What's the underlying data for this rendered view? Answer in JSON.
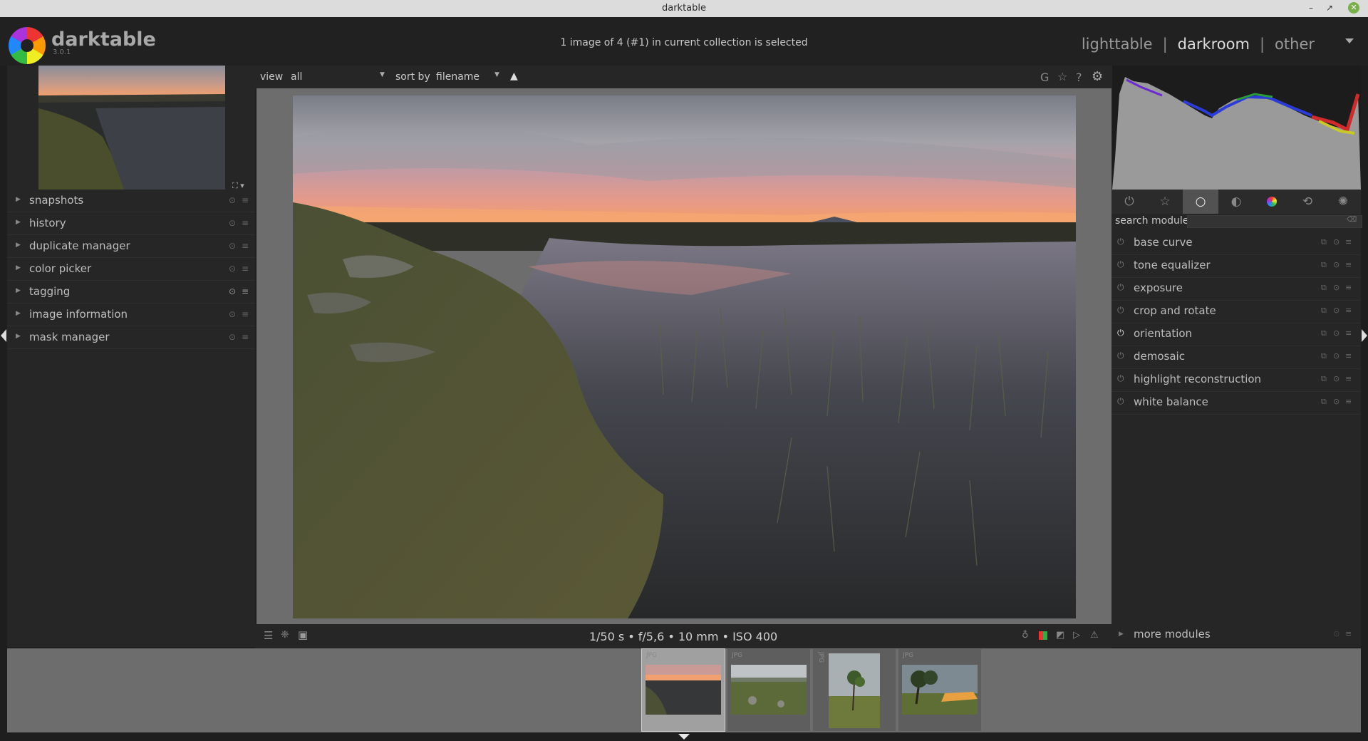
{
  "window": {
    "title": "darktable"
  },
  "header": {
    "brand": "darktable",
    "version": "3.0.1",
    "collection_info": "1 image of 4 (#1) in current collection is selected",
    "views": [
      "lighttable",
      "darkroom",
      "other"
    ],
    "active_view": "darkroom",
    "separator": "|"
  },
  "left_panel": {
    "modules": [
      "snapshots",
      "history",
      "duplicate manager",
      "color picker",
      "tagging",
      "image information",
      "mask manager"
    ]
  },
  "toolbar": {
    "view_label": "view",
    "view_value": "all",
    "sort_label": "sort by",
    "sort_value": "filename",
    "right_icons": [
      "G",
      "☆",
      "?",
      "⚙"
    ]
  },
  "image": {
    "exif": "1/50 s • f/5,6 • 10 mm • ISO 400"
  },
  "right_panel": {
    "search_label": "search module",
    "search_value": "",
    "group_tabs": [
      "power-icon",
      "favourites-icon",
      "base-icon",
      "tone-icon",
      "color-icon",
      "correct-icon",
      "effect-icon"
    ],
    "active_group": "base-icon",
    "modules": [
      "base curve",
      "tone equalizer",
      "exposure",
      "crop and rotate",
      "orientation",
      "demosaic",
      "highlight reconstruction",
      "white balance"
    ],
    "more_modules": "more modules"
  },
  "filmstrip": {
    "format_label": "JPG",
    "selected_index": 0,
    "thumbs": [
      "thumb-1",
      "thumb-2",
      "thumb-3",
      "thumb-4"
    ]
  },
  "colors": {
    "panel": "#262626",
    "center": "#6d6d6d",
    "accent_active": "#dcdcdc"
  }
}
